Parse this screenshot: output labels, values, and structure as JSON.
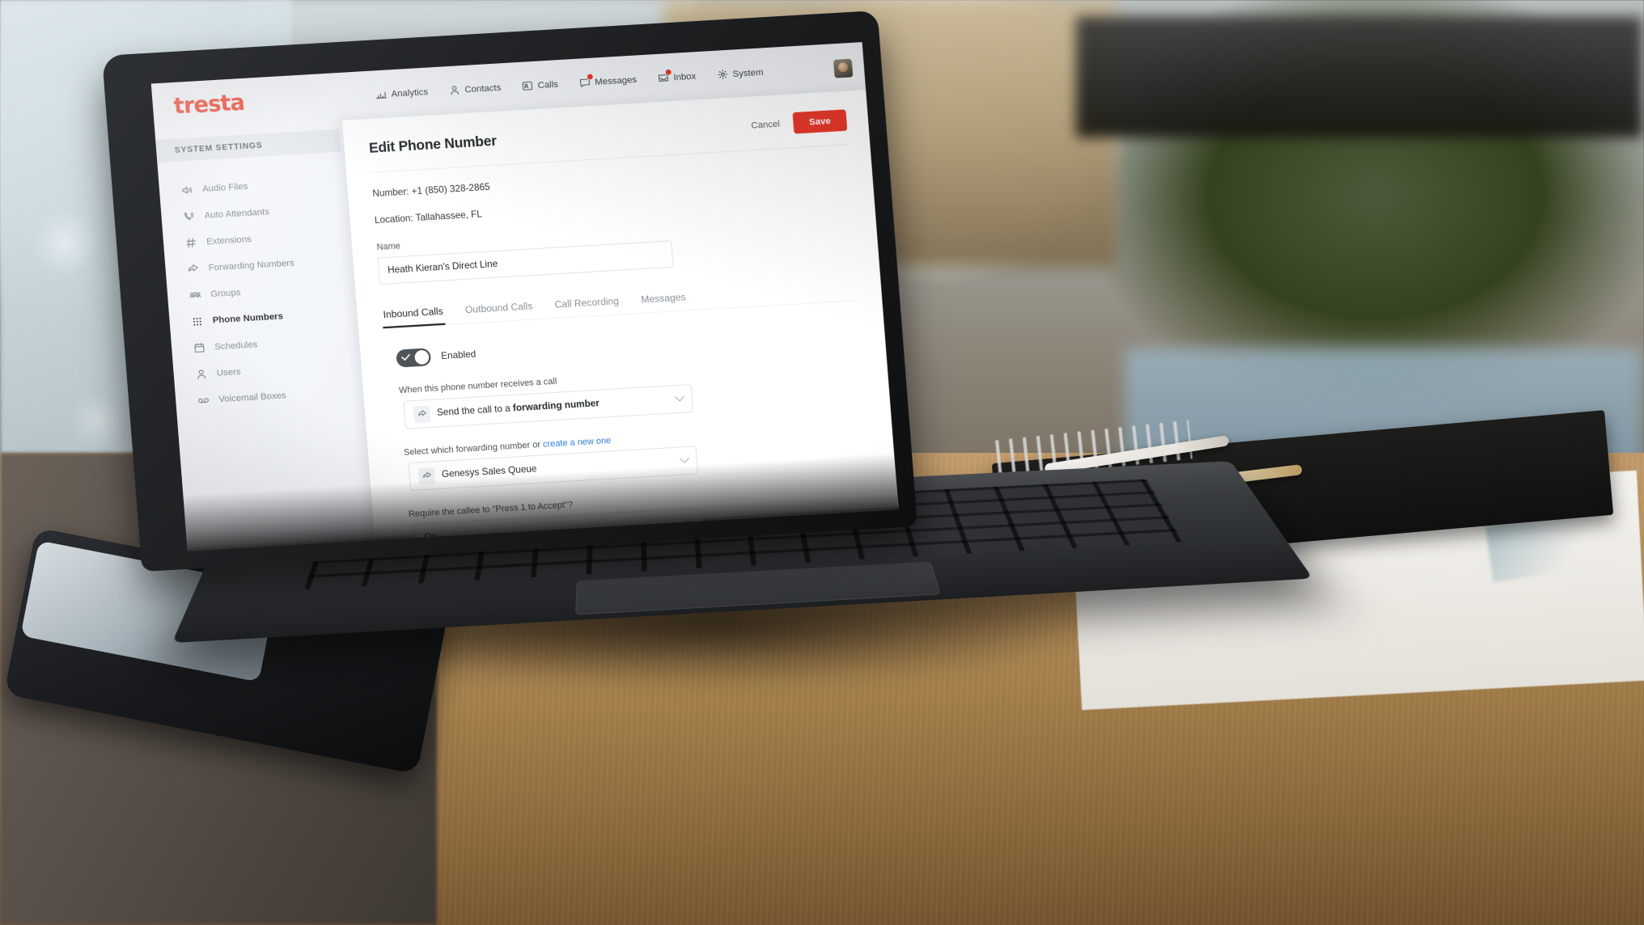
{
  "brand": {
    "logo_text": "tresta",
    "accent_color": "#e8392a",
    "logo_color": "#ef4836"
  },
  "topnav": {
    "items": [
      {
        "label": "Analytics",
        "icon": "analytics-bars-icon",
        "badge": false
      },
      {
        "label": "Contacts",
        "icon": "person-icon",
        "badge": false
      },
      {
        "label": "Calls",
        "icon": "call-card-icon",
        "badge": false
      },
      {
        "label": "Messages",
        "icon": "message-icon",
        "badge": true
      },
      {
        "label": "Inbox",
        "icon": "inbox-icon",
        "badge": true
      },
      {
        "label": "System",
        "icon": "gear-icon",
        "badge": false
      }
    ]
  },
  "sidebar": {
    "header": "SYSTEM SETTINGS",
    "items": [
      {
        "label": "Audio Files",
        "icon": "speaker-icon",
        "active": false
      },
      {
        "label": "Auto Attendants",
        "icon": "phone-waves-icon",
        "active": false
      },
      {
        "label": "Extensions",
        "icon": "hash-icon",
        "active": false
      },
      {
        "label": "Forwarding Numbers",
        "icon": "forward-arrow-icon",
        "active": false
      },
      {
        "label": "Groups",
        "icon": "people-group-icon",
        "active": false
      },
      {
        "label": "Phone Numbers",
        "icon": "grid-dots-icon",
        "active": true
      },
      {
        "label": "Schedules",
        "icon": "calendar-icon",
        "active": false
      },
      {
        "label": "Users",
        "icon": "user-icon",
        "active": false
      },
      {
        "label": "Voicemail Boxes",
        "icon": "voicemail-icon",
        "active": false
      }
    ]
  },
  "main": {
    "title": "Edit Phone Number",
    "cancel_label": "Cancel",
    "save_label": "Save",
    "number_line": "Number: +1 (850) 328-2865",
    "location_line": "Location: Tallahassee, FL",
    "name_label": "Name",
    "name_value": "Heath Kieran's Direct Line",
    "tabs": [
      {
        "label": "Inbound Calls",
        "active": true
      },
      {
        "label": "Outbound Calls",
        "active": false
      },
      {
        "label": "Call Recording",
        "active": false
      },
      {
        "label": "Messages",
        "active": false
      }
    ],
    "toggle": {
      "label": "Enabled",
      "state": "on"
    },
    "routing": {
      "question": "When this phone number receives a call",
      "value_prefix": "Send the call to a ",
      "value_bold": "forwarding number",
      "icon": "forward-arrow-icon"
    },
    "forwarding": {
      "question_prefix": "Select which forwarding number or ",
      "question_link": "create a new one",
      "value": "Genesys Sales Queue",
      "icon": "forward-arrow-icon"
    },
    "press_one": {
      "question": "Require the callee to \"Press 1 to Accept\"?",
      "value": "On"
    }
  }
}
